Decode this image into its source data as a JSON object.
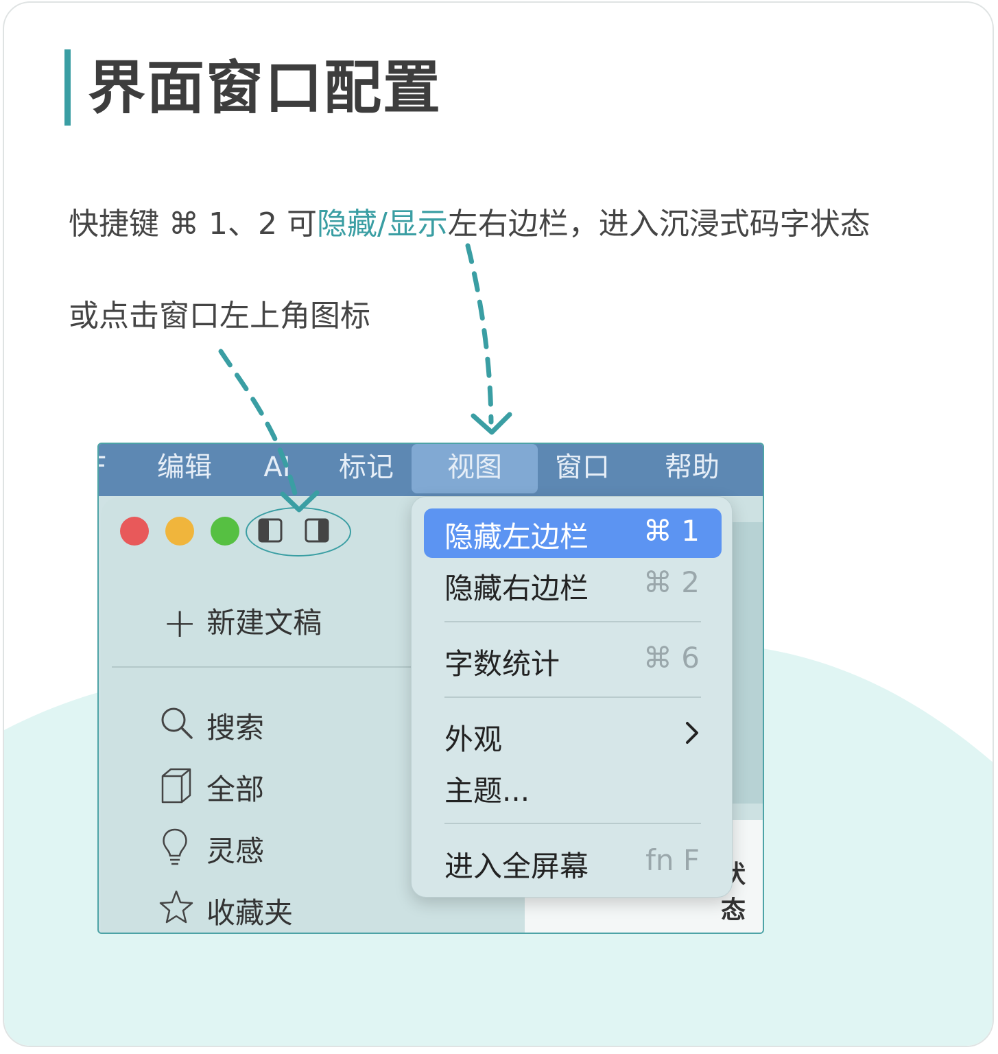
{
  "heading": {
    "title": "界面窗口配置"
  },
  "description": {
    "line1_prefix": "快捷键 ⌘ 1、2 可",
    "line1_highlight": "隐藏/显示",
    "line1_suffix": "左右边栏，进入沉浸式码字状态",
    "line2": "或点击窗口左上角图标"
  },
  "colors": {
    "accent": "#3a9ea3",
    "menubar": "#5d88b3",
    "selected": "#5c94f2"
  },
  "menubar": {
    "items": [
      {
        "label": "F"
      },
      {
        "label": "编辑"
      },
      {
        "label": "AI"
      },
      {
        "label": "标记"
      },
      {
        "label": "视图"
      },
      {
        "label": "窗口"
      },
      {
        "label": "帮助"
      }
    ]
  },
  "sidebar": {
    "new_doc": "新建文稿",
    "items": [
      {
        "label": "搜索",
        "icon": "search-icon"
      },
      {
        "label": "全部",
        "icon": "box-icon"
      },
      {
        "label": "灵感",
        "icon": "lightbulb-icon"
      },
      {
        "label": "收藏夹",
        "icon": "star-icon"
      }
    ]
  },
  "editor": {
    "partial_text": "状态"
  },
  "view_menu": {
    "items": [
      {
        "label": "隐藏左边栏",
        "shortcut": "⌘ 1"
      },
      {
        "label": "隐藏右边栏",
        "shortcut": "⌘ 2"
      },
      {
        "label": "字数统计",
        "shortcut": "⌘ 6"
      },
      {
        "label": "外观",
        "submenu": true
      },
      {
        "label": "主题..."
      },
      {
        "label": "进入全屏幕",
        "shortcut": "fn F"
      }
    ]
  }
}
